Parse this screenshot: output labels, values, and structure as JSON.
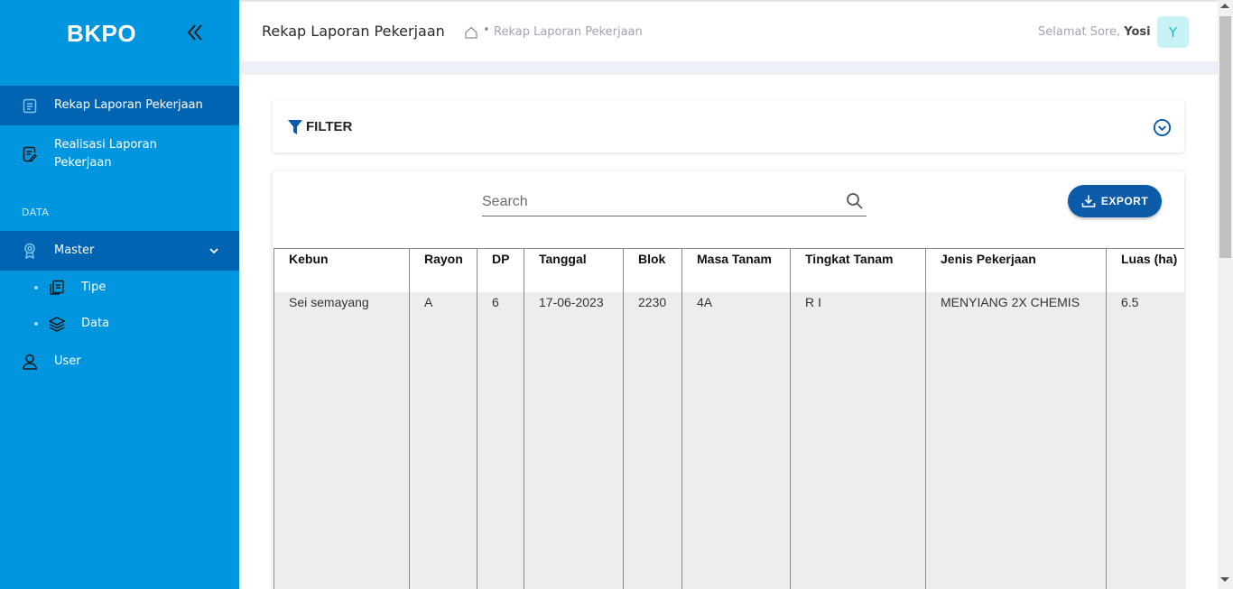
{
  "app": {
    "brand": "BKPO"
  },
  "sidebar": {
    "items": [
      {
        "label": "Rekap Laporan Pekerjaan",
        "active": true,
        "icon": "clipboard-icon"
      },
      {
        "label": "Realisasi Laporan Pekerjaan",
        "active": false,
        "icon": "edit-document-icon"
      }
    ],
    "section_label": "DATA",
    "master": {
      "label": "Master",
      "icon": "badge-icon",
      "expanded": true,
      "children": [
        {
          "label": "Tipe",
          "icon": "copy-icon"
        },
        {
          "label": "Data",
          "icon": "layers-icon"
        }
      ]
    },
    "user": {
      "label": "User",
      "icon": "user-icon"
    }
  },
  "header": {
    "title": "Rekap Laporan Pekerjaan",
    "breadcrumb_separator": "•",
    "breadcrumb_current": "Rekap Laporan Pekerjaan",
    "greeting_prefix": "Selamat Sore, ",
    "user_name": "Yosi",
    "avatar_initial": "Y"
  },
  "filter": {
    "label": "FILTER"
  },
  "table_toolbar": {
    "search_placeholder": "Search",
    "export_label": "EXPORT"
  },
  "table": {
    "columns": [
      "Kebun",
      "Rayon",
      "DP",
      "Tanggal",
      "Blok",
      "Masa Tanam",
      "Tingkat Tanam",
      "Jenis Pekerjaan",
      "Luas (ha)"
    ],
    "rows": [
      [
        "Sei semayang",
        "A",
        "6",
        "17-06-2023",
        "2230",
        "4A",
        "R I",
        "MENYIANG 2X CHEMIS",
        "6.5"
      ]
    ]
  },
  "colors": {
    "sidebar_bg": "#0096df",
    "sidebar_active": "#0064b2",
    "primary_button": "#0b5ba8",
    "avatar_bg": "#c9f2f6"
  }
}
